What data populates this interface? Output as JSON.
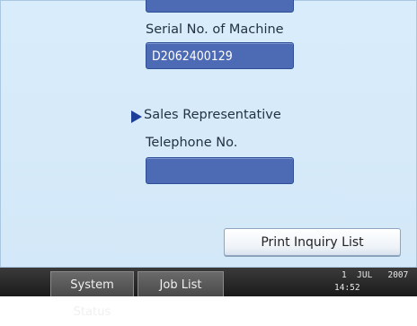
{
  "serial": {
    "label": "Serial No. of Machine",
    "value": "D2062400129"
  },
  "sales_rep": {
    "heading": "Sales Representative",
    "telephone_label": "Telephone No.",
    "telephone_value": ""
  },
  "actions": {
    "print_label": "Print Inquiry List"
  },
  "taskbar": {
    "system_status_label": "System Status",
    "job_list_label": "Job List",
    "date": "1  JUL   2007",
    "time": "14:52"
  },
  "colors": {
    "field_blue": "#4d6bb4",
    "background": "#d9ecfb",
    "arrow": "#1e3f97",
    "taskbar": "#2a2a2a"
  }
}
